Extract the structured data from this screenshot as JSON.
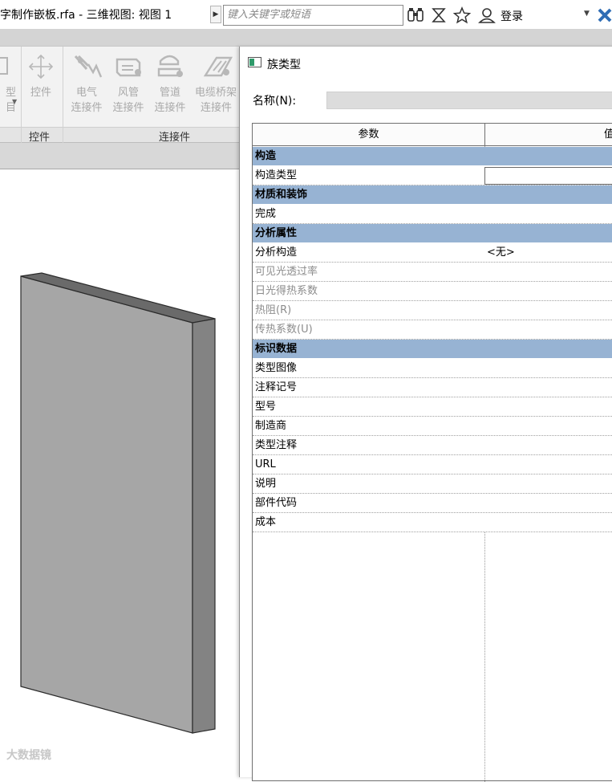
{
  "titlebar": {
    "doc_title": "字制作嵌板.rfa - 三维视图: 视图 1",
    "search_placeholder": "键入关键字或短语",
    "login": "登录"
  },
  "ribbon": {
    "partial_btn_line1": "型",
    "partial_btn_line2": "目",
    "control_btn": "控件",
    "electrical_1": "电气",
    "electrical_2": "连接件",
    "duct_1": "风管",
    "duct_2": "连接件",
    "pipe_1": "管道",
    "pipe_2": "连接件",
    "cabletray_1": "电缆桥架",
    "cabletray_2": "连接件",
    "panel_control": "控件",
    "panel_connectors": "连接件"
  },
  "canvas": {
    "watermark": "大数据镜"
  },
  "dialog": {
    "title": "族类型",
    "name_label": "名称(N):",
    "name_value": "",
    "col_param": "参数",
    "col_value": "值",
    "groups": [
      {
        "name": "构造",
        "rows": [
          {
            "name": "构造类型",
            "value": "",
            "editing": true
          }
        ]
      },
      {
        "name": "材质和装饰",
        "rows": [
          {
            "name": "完成",
            "value": ""
          }
        ]
      },
      {
        "name": "分析属性",
        "rows": [
          {
            "name": "分析构造",
            "value": "<无>"
          },
          {
            "name": "可见光透过率",
            "value": "",
            "disabled": true
          },
          {
            "name": "日光得热系数",
            "value": "",
            "disabled": true
          },
          {
            "name": "热阻(R)",
            "value": "",
            "disabled": true
          },
          {
            "name": "传热系数(U)",
            "value": "",
            "disabled": true
          }
        ]
      },
      {
        "name": "标识数据",
        "rows": [
          {
            "name": "类型图像",
            "value": ""
          },
          {
            "name": "注释记号",
            "value": ""
          },
          {
            "name": "型号",
            "value": ""
          },
          {
            "name": "制造商",
            "value": ""
          },
          {
            "name": "类型注释",
            "value": ""
          },
          {
            "name": "URL",
            "value": ""
          },
          {
            "name": "说明",
            "value": ""
          },
          {
            "name": "部件代码",
            "value": ""
          },
          {
            "name": "成本",
            "value": ""
          }
        ]
      }
    ]
  },
  "colors": {
    "group_header": "#97b3d3",
    "panel_fill": "#a6a6a6",
    "panel_side": "#838383",
    "panel_top": "#6a6a6a"
  }
}
